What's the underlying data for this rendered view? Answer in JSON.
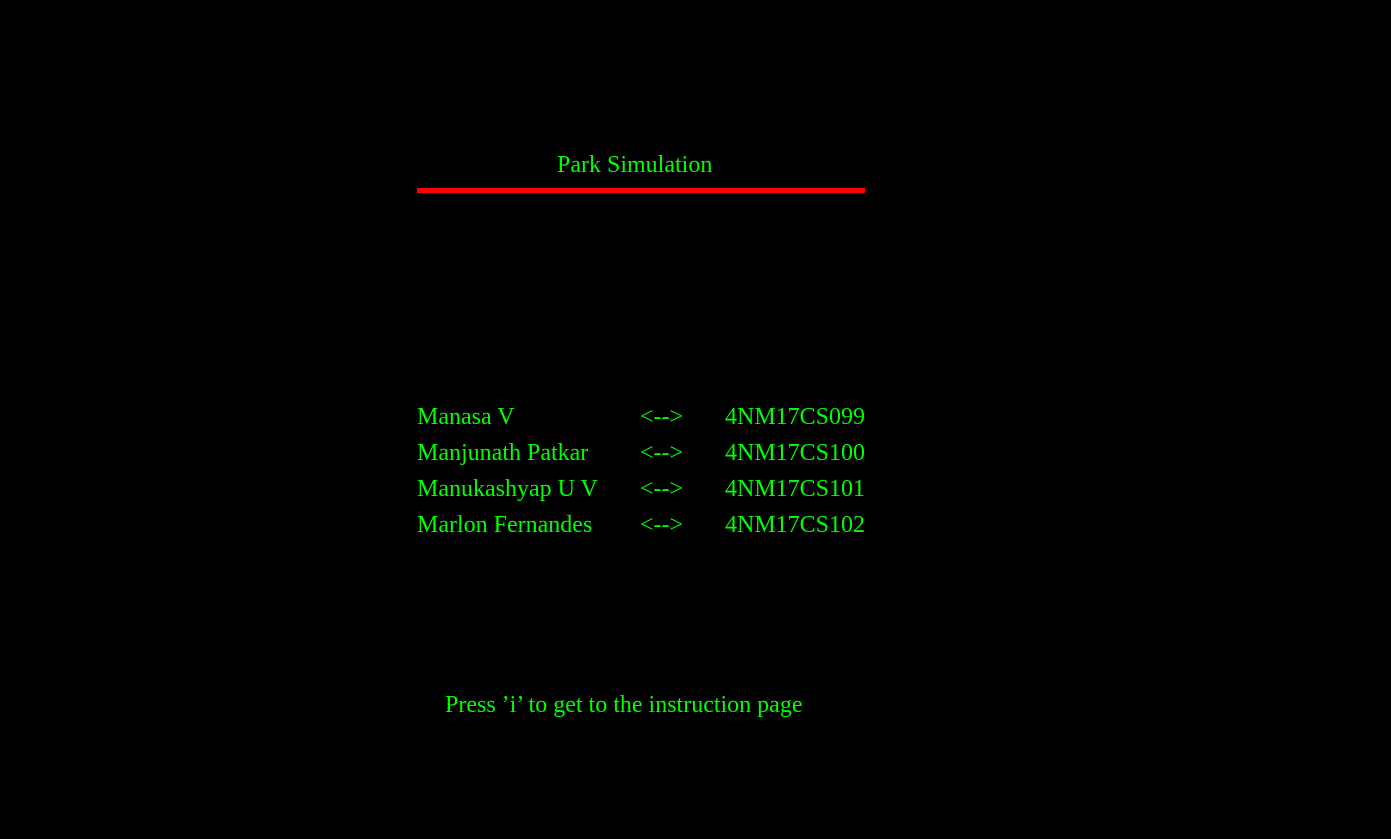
{
  "title": "Park Simulation",
  "colors": {
    "background": "#000000",
    "text": "#00ff00",
    "underline": "#ff0000"
  },
  "members": [
    {
      "name": "Manasa V",
      "arrow": "<-->",
      "usn": "4NM17CS099"
    },
    {
      "name": "Manjunath Patkar",
      "arrow": "<-->",
      "usn": "4NM17CS100"
    },
    {
      "name": "Manukashyap U V",
      "arrow": "<-->",
      "usn": "4NM17CS101"
    },
    {
      "name": "Marlon Fernandes",
      "arrow": "<-->",
      "usn": "4NM17CS102"
    }
  ],
  "prompt": "Press ’i’ to get to the instruction page"
}
